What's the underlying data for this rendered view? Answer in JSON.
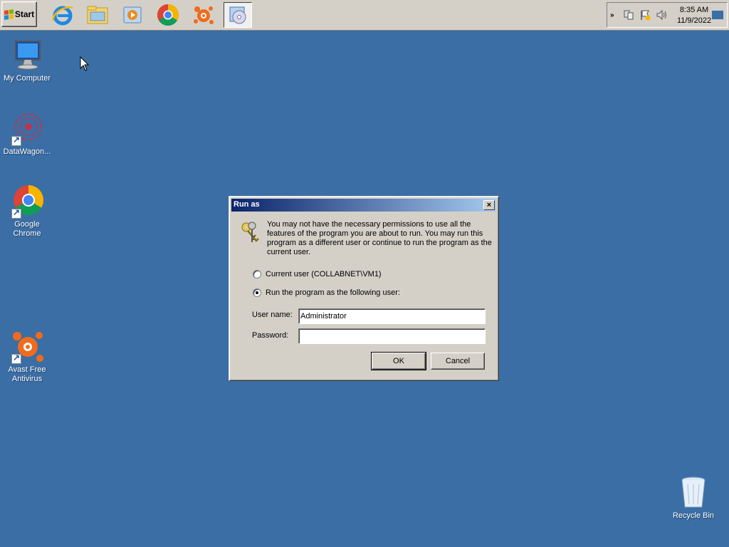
{
  "taskbar": {
    "start_label": "Start",
    "quick_launch": [
      {
        "name": "internet-explorer-icon"
      },
      {
        "name": "windows-explorer-icon"
      },
      {
        "name": "media-player-icon"
      },
      {
        "name": "chrome-icon"
      },
      {
        "name": "avast-icon"
      },
      {
        "name": "setup-disc-icon",
        "active": true
      }
    ],
    "tray": {
      "expand_glyph": "»",
      "time": "8:35 AM",
      "date": "11/9/2022"
    }
  },
  "desktop": {
    "icons": [
      {
        "name": "my-computer",
        "label": "My Computer"
      },
      {
        "name": "datawagon",
        "label": "DataWagon..."
      },
      {
        "name": "google-chrome",
        "label": "Google Chrome"
      },
      {
        "name": "avast-free-antivirus",
        "label": "Avast Free Antivirus"
      },
      {
        "name": "recycle-bin",
        "label": "Recycle Bin"
      }
    ]
  },
  "dialog": {
    "title": "Run as",
    "close_glyph": "×",
    "message": "You may not have the necessary permissions to use all the features of the program you are about to run. You may run this program as a different user or continue to run the program as the current user.",
    "option_current": "Current user (COLLABNET\\VM1)",
    "option_other": "Run the program as the following user:",
    "selected_option": "other",
    "username_label": "User name:",
    "username_value": "Administrator",
    "password_label": "Password:",
    "password_value": "",
    "ok_label": "OK",
    "cancel_label": "Cancel"
  },
  "colors": {
    "desktop": "#3b6ea5",
    "titlebar_start": "#0a246a",
    "titlebar_end": "#a6caf0",
    "window_face": "#d4d0c8"
  }
}
